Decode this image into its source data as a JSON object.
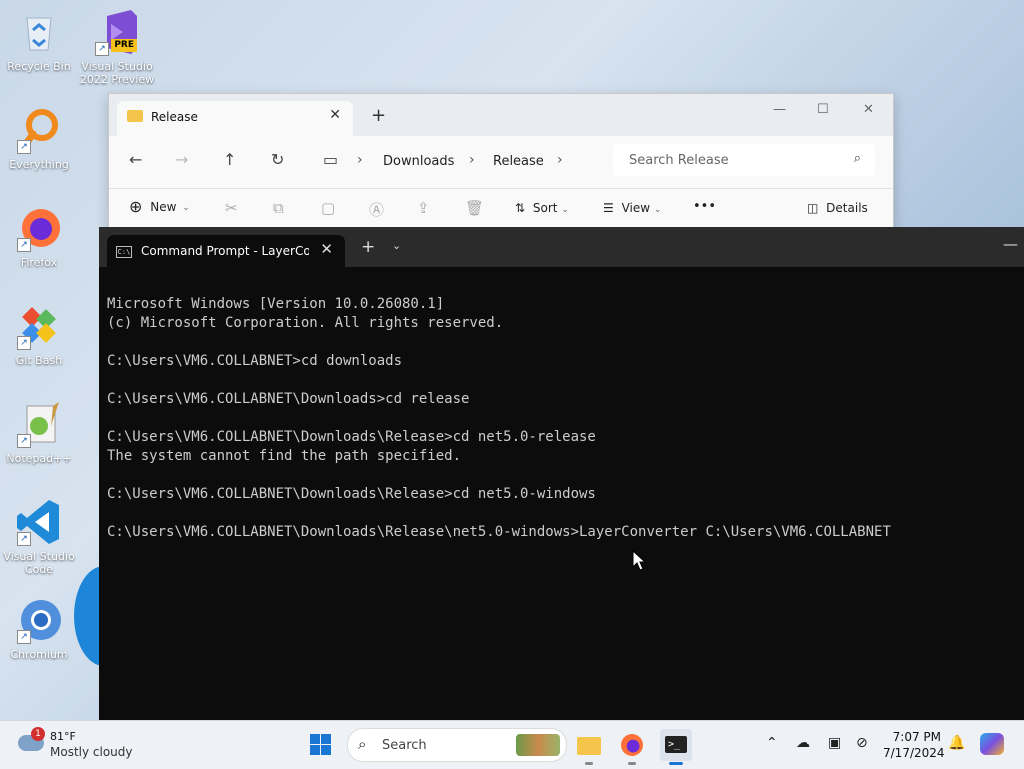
{
  "desktop": {
    "icons": [
      {
        "label": "Recycle Bin",
        "icon": "recycle-bin-icon"
      },
      {
        "label": "Visual Studio 2022 Preview",
        "badge": "PRE",
        "icon": "visual-studio-icon"
      },
      {
        "label": "Everything",
        "icon": "everything-search-icon"
      },
      {
        "label": "Firefox",
        "icon": "firefox-icon"
      },
      {
        "label": "Git Bash",
        "icon": "git-bash-icon"
      },
      {
        "label": "Notepad++",
        "icon": "notepad-plus-plus-icon"
      },
      {
        "label": "Visual Studio Code",
        "icon": "vscode-icon"
      },
      {
        "label": "Chromium",
        "icon": "chromium-icon"
      }
    ]
  },
  "explorer": {
    "tab_title": "Release",
    "breadcrumb": [
      "Downloads",
      "Release"
    ],
    "search_placeholder": "Search Release",
    "toolbar": {
      "new": "New",
      "sort": "Sort",
      "view": "View",
      "more": "•••",
      "details": "Details"
    }
  },
  "terminal": {
    "tab_title": "Command Prompt - LayerCon",
    "lines": [
      "Microsoft Windows [Version 10.0.26080.1]",
      "(c) Microsoft Corporation. All rights reserved.",
      "",
      "C:\\Users\\VM6.COLLABNET>cd downloads",
      "",
      "C:\\Users\\VM6.COLLABNET\\Downloads>cd release",
      "",
      "C:\\Users\\VM6.COLLABNET\\Downloads\\Release>cd net5.0-release",
      "The system cannot find the path specified.",
      "",
      "C:\\Users\\VM6.COLLABNET\\Downloads\\Release>cd net5.0-windows",
      "",
      "C:\\Users\\VM6.COLLABNET\\Downloads\\Release\\net5.0-windows>LayerConverter C:\\Users\\VM6.COLLABNET"
    ]
  },
  "taskbar": {
    "weather_badge": "1",
    "temperature": "81°F",
    "condition": "Mostly cloudy",
    "search_placeholder": "Search",
    "time": "7:07 PM",
    "date": "7/17/2024"
  }
}
